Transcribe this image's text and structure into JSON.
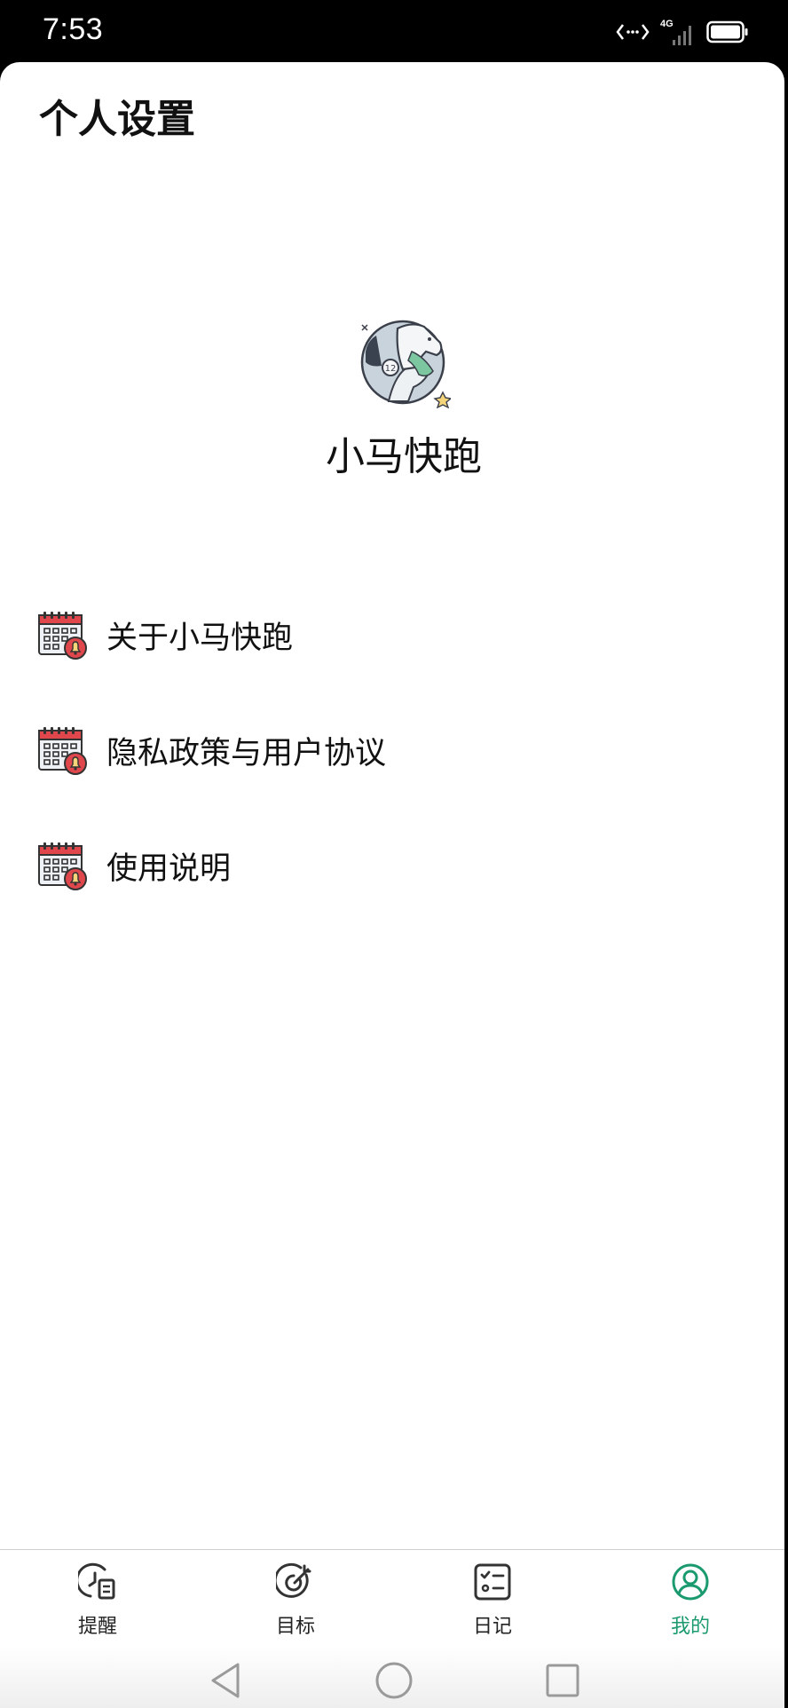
{
  "status_bar": {
    "time": "7:53",
    "network": "4G",
    "icons": [
      "data-transfer-icon",
      "signal-icon",
      "battery-icon"
    ]
  },
  "page": {
    "title": "个人设置"
  },
  "profile": {
    "avatar_icon": "horse-avatar-icon",
    "name": "小马快跑"
  },
  "menu": {
    "items": [
      {
        "label": "关于小马快跑",
        "icon": "calendar-bell-icon"
      },
      {
        "label": "隐私政策与用户协议",
        "icon": "calendar-bell-icon"
      },
      {
        "label": "使用说明",
        "icon": "calendar-bell-icon"
      }
    ]
  },
  "tab_bar": {
    "active": "我的",
    "active_color": "#1a9a6e",
    "tabs": [
      {
        "label": "提醒",
        "icon": "reminder-clock-icon"
      },
      {
        "label": "目标",
        "icon": "target-icon"
      },
      {
        "label": "日记",
        "icon": "checklist-icon"
      },
      {
        "label": "我的",
        "icon": "user-profile-icon"
      }
    ]
  },
  "system_nav": {
    "buttons": [
      "back-triangle-icon",
      "home-circle-icon",
      "recents-square-icon"
    ]
  }
}
